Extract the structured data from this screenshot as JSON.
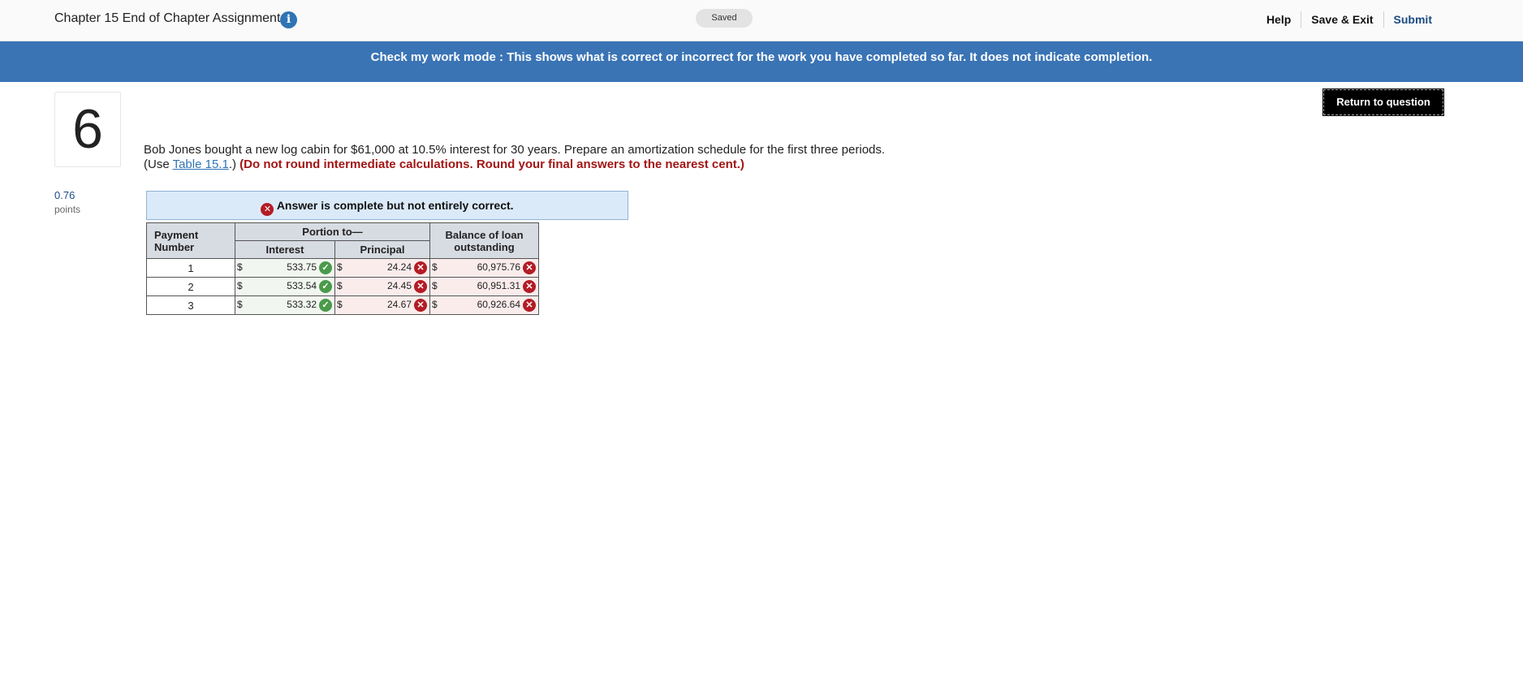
{
  "header": {
    "assignment_title": "Chapter 15 End of Chapter Assignment",
    "saved_label": "Saved",
    "help_label": "Help",
    "save_exit_label": "Save & Exit",
    "submit_label": "Submit"
  },
  "banner": {
    "text": "Check my work mode : This shows what is correct or incorrect for the work you have completed so far. It does not indicate completion."
  },
  "question": {
    "number": "6",
    "points_value": "0.76",
    "points_label": "points",
    "return_button": "Return to question",
    "text_part1": "Bob Jones bought a new log cabin for $61,000 at 10.5% interest for 30 years. Prepare an amortization schedule for the first three periods. (Use ",
    "link_text": "Table 15.1",
    "text_part2": ".) ",
    "instruction": "(Do not round intermediate calculations. Round your final answers to the nearest cent.)"
  },
  "status": {
    "message": "Answer is complete but not entirely correct."
  },
  "table": {
    "headers": {
      "payment_number": "Payment Number",
      "portion_to": "Portion to—",
      "interest": "Interest",
      "principal": "Principal",
      "balance": "Balance of loan outstanding"
    },
    "currency": "$",
    "rows": [
      {
        "num": "1",
        "interest": "533.75",
        "interest_status": "correct",
        "principal": "24.24",
        "principal_status": "incorrect",
        "balance": "60,975.76",
        "balance_status": "incorrect"
      },
      {
        "num": "2",
        "interest": "533.54",
        "interest_status": "correct",
        "principal": "24.45",
        "principal_status": "incorrect",
        "balance": "60,951.31",
        "balance_status": "incorrect"
      },
      {
        "num": "3",
        "interest": "533.32",
        "interest_status": "correct",
        "principal": "24.67",
        "principal_status": "incorrect",
        "balance": "60,926.64",
        "balance_status": "incorrect"
      }
    ]
  },
  "icons": {
    "info": "info-icon",
    "correct": "check-icon",
    "incorrect": "x-icon"
  },
  "colors": {
    "banner": "#3a74b5",
    "correct": "#4b9a4b",
    "incorrect": "#b31c25",
    "instruction": "#a31515"
  }
}
